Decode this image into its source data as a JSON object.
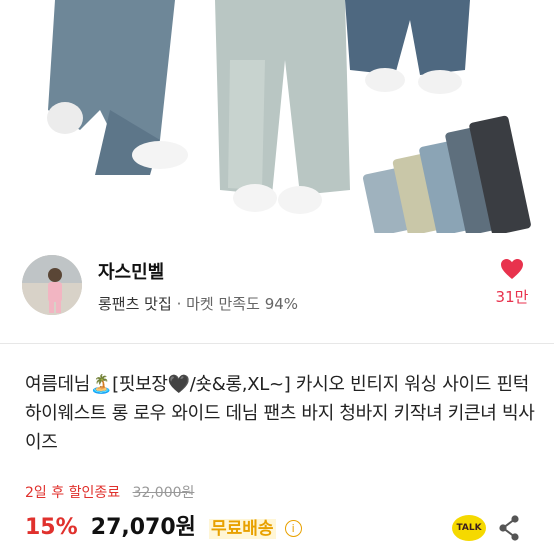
{
  "seller": {
    "name": "자스민벨",
    "category": "롱팬츠 맛집",
    "separator": "·",
    "satisfaction_label": "마켓 만족도",
    "satisfaction_value": "94%",
    "likes": "31만"
  },
  "product": {
    "title": "여름데님🏝️[핏보장🖤/숏&롱,XL~] 카시오 빈티지 워싱 사이드 핀턱 하이웨스트 롱 로우 와이드 데님 팬츠 바지 청바지 키작녀 키큰녀 빅사이즈",
    "sale_end": "2일 후 할인종료",
    "original_price": "32,000원",
    "discount": "15%",
    "price": "27,070원",
    "shipping": "무료배송",
    "info_glyph": "i"
  },
  "actions": {
    "talk_label": "TALK"
  },
  "colors": {
    "accent_red": "#e0312d",
    "heart": "#e8324d",
    "shipping": "#e8a100",
    "talk": "#f5d900"
  },
  "icons": [
    "heart-icon",
    "info-icon",
    "kakao-talk-icon",
    "share-icon"
  ]
}
